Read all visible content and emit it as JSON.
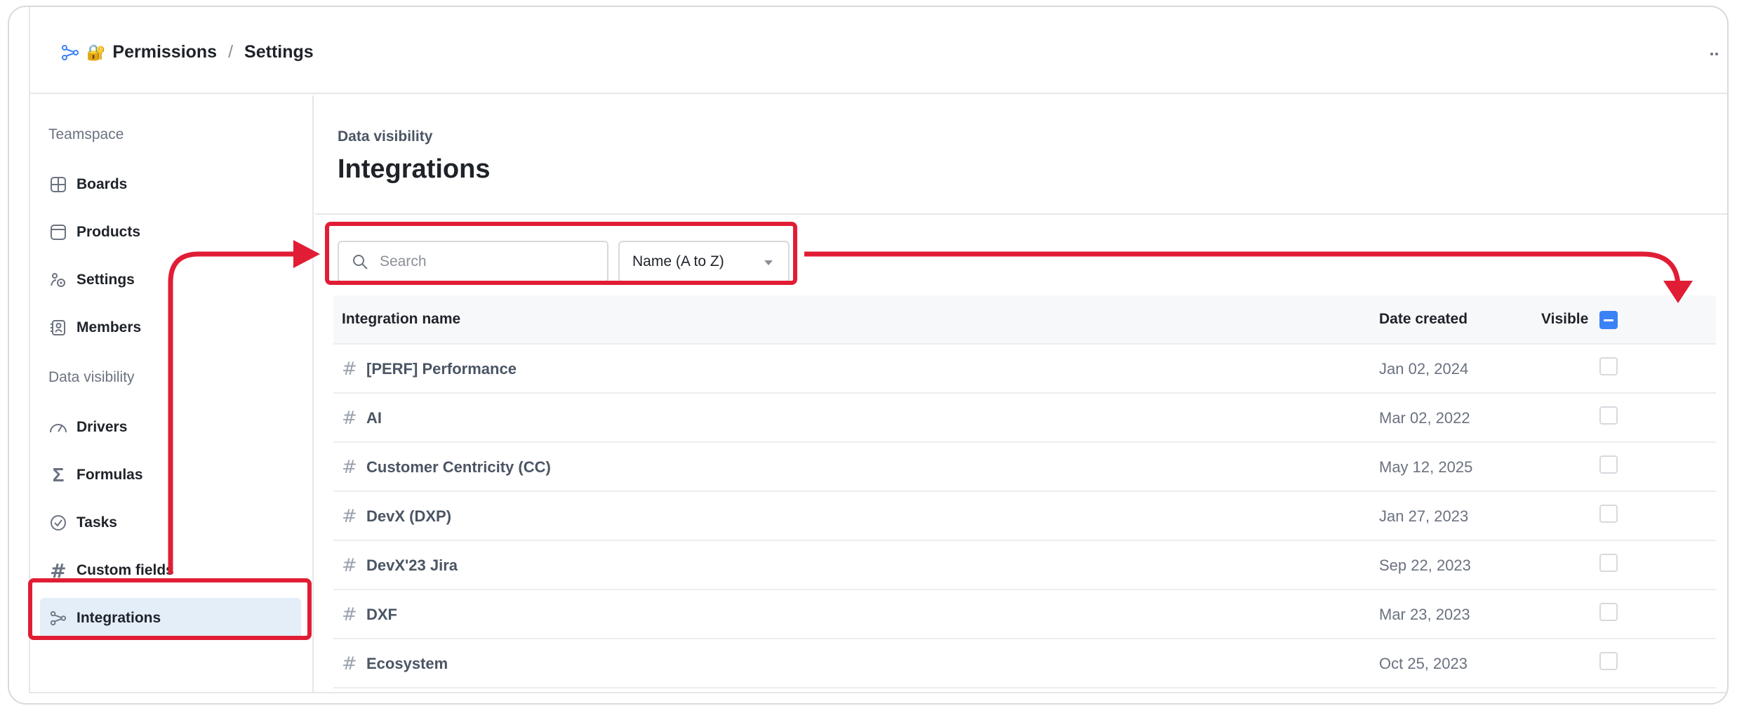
{
  "header": {
    "workspace_icon": "integrations-graph-icon",
    "emoji": "🔐",
    "crumb_1": "Permissions",
    "separator": "/",
    "crumb_2": "Settings",
    "more_icon": "more-dots-icon"
  },
  "sidebar": {
    "section_1": "Teamspace",
    "items_1": [
      {
        "label": "Boards",
        "icon": "grid-icon"
      },
      {
        "label": "Products",
        "icon": "window-icon"
      },
      {
        "label": "Settings",
        "icon": "settings-icon"
      },
      {
        "label": "Members",
        "icon": "members-icon"
      }
    ],
    "section_2": "Data visibility",
    "items_2": [
      {
        "label": "Drivers",
        "icon": "gauge-icon"
      },
      {
        "label": "Formulas",
        "icon": "sigma-icon"
      },
      {
        "label": "Tasks",
        "icon": "check-circle-icon"
      },
      {
        "label": "Custom fields",
        "icon": "hash-icon"
      },
      {
        "label": "Integrations",
        "icon": "integrations-icon",
        "active": true
      }
    ]
  },
  "main": {
    "eyebrow": "Data visibility",
    "title": "Integrations",
    "search": {
      "placeholder": "Search",
      "value": ""
    },
    "sort": {
      "selected": "Name (A to Z)"
    },
    "table": {
      "columns": [
        "Integration name",
        "Date created",
        "Visible"
      ],
      "header_checkbox": "indeterminate",
      "rows": [
        {
          "name": "[PERF] Performance",
          "date": "Jan 02, 2024",
          "visible": false
        },
        {
          "name": "AI",
          "date": "Mar 02, 2022",
          "visible": false
        },
        {
          "name": "Customer Centricity (CC)",
          "date": "May 12, 2025",
          "visible": false
        },
        {
          "name": "DevX (DXP)",
          "date": "Jan 27, 2023",
          "visible": false
        },
        {
          "name": "DevX'23 Jira",
          "date": "Sep 22, 2023",
          "visible": false
        },
        {
          "name": "DXF",
          "date": "Mar 23, 2023",
          "visible": false
        },
        {
          "name": "Ecosystem",
          "date": "Oct 25, 2023",
          "visible": false
        }
      ]
    }
  },
  "annotation_color": "#e11d35",
  "accent_color": "#3b82f6"
}
